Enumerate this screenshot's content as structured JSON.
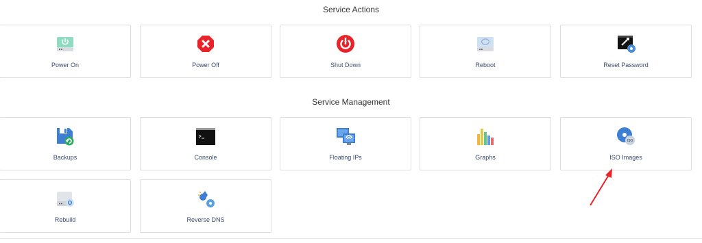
{
  "sections": {
    "actions": {
      "title": "Service Actions",
      "items": [
        "Power On",
        "Power Off",
        "Shut Down",
        "Reboot",
        "Reset Password"
      ]
    },
    "management": {
      "title": "Service Management",
      "items": [
        "Backups",
        "Console",
        "Floating IPs",
        "Graphs",
        "ISO Images",
        "Rebuild",
        "Reverse DNS"
      ]
    }
  },
  "icons": {
    "power_on": "power-on-icon",
    "power_off": "power-off-icon",
    "shut_down": "shut-down-icon",
    "reboot": "reboot-icon",
    "reset_password": "reset-password-icon",
    "backups": "backups-icon",
    "console": "console-icon",
    "floating_ips": "floating-ips-icon",
    "graphs": "graphs-icon",
    "iso_images": "iso-images-icon",
    "rebuild": "rebuild-icon",
    "reverse_dns": "reverse-dns-icon"
  },
  "colors": {
    "accent_red": "#e8242a",
    "label_text": "#3a4a6b",
    "card_border": "#dedede"
  }
}
